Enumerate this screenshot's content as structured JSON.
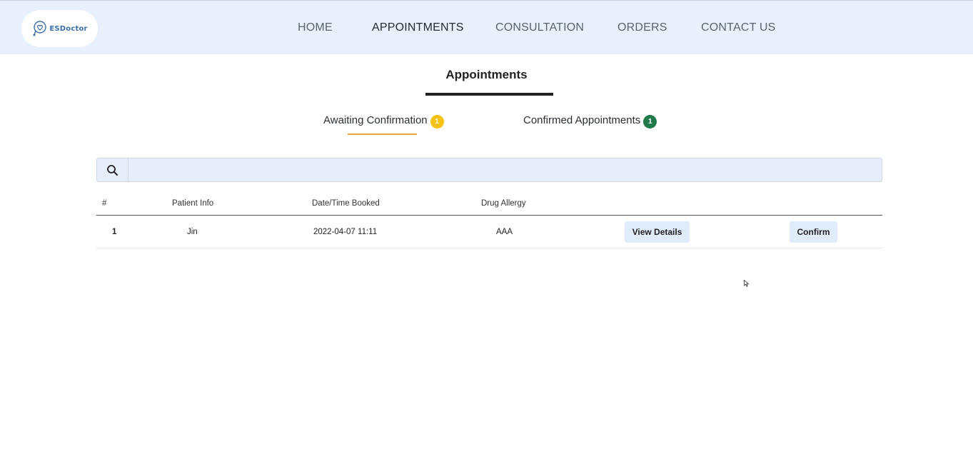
{
  "brand": {
    "logo_text": "ESDoctor"
  },
  "nav": {
    "items": [
      {
        "label": "HOME"
      },
      {
        "label": "APPOINTMENTS"
      },
      {
        "label": "CONSULTATION"
      },
      {
        "label": "ORDERS"
      },
      {
        "label": "CONTACT US"
      }
    ],
    "active": "APPOINTMENTS"
  },
  "page": {
    "title": "Appointments"
  },
  "tabs": [
    {
      "label": "Awaiting Confirmation",
      "count": "1",
      "badge_color": "#f5c211",
      "active": true
    },
    {
      "label": "Confirmed Appointments",
      "count": "1",
      "badge_color": "#217a4b",
      "active": false
    }
  ],
  "search": {
    "placeholder": "",
    "value": ""
  },
  "table": {
    "headers": [
      "#",
      "Patient Info",
      "Date/Time Booked",
      "Drug Allergy"
    ],
    "rows": [
      {
        "index": "1",
        "patient": "Jin",
        "booked": "2022-04-07 11:11",
        "allergy": "AAA",
        "details_label": "View Details",
        "confirm_label": "Confirm"
      }
    ]
  },
  "colors": {
    "header_bg": "#e8f0fb",
    "tab_underline": "#e8a43a",
    "button_bg": "#e1ecfa"
  }
}
